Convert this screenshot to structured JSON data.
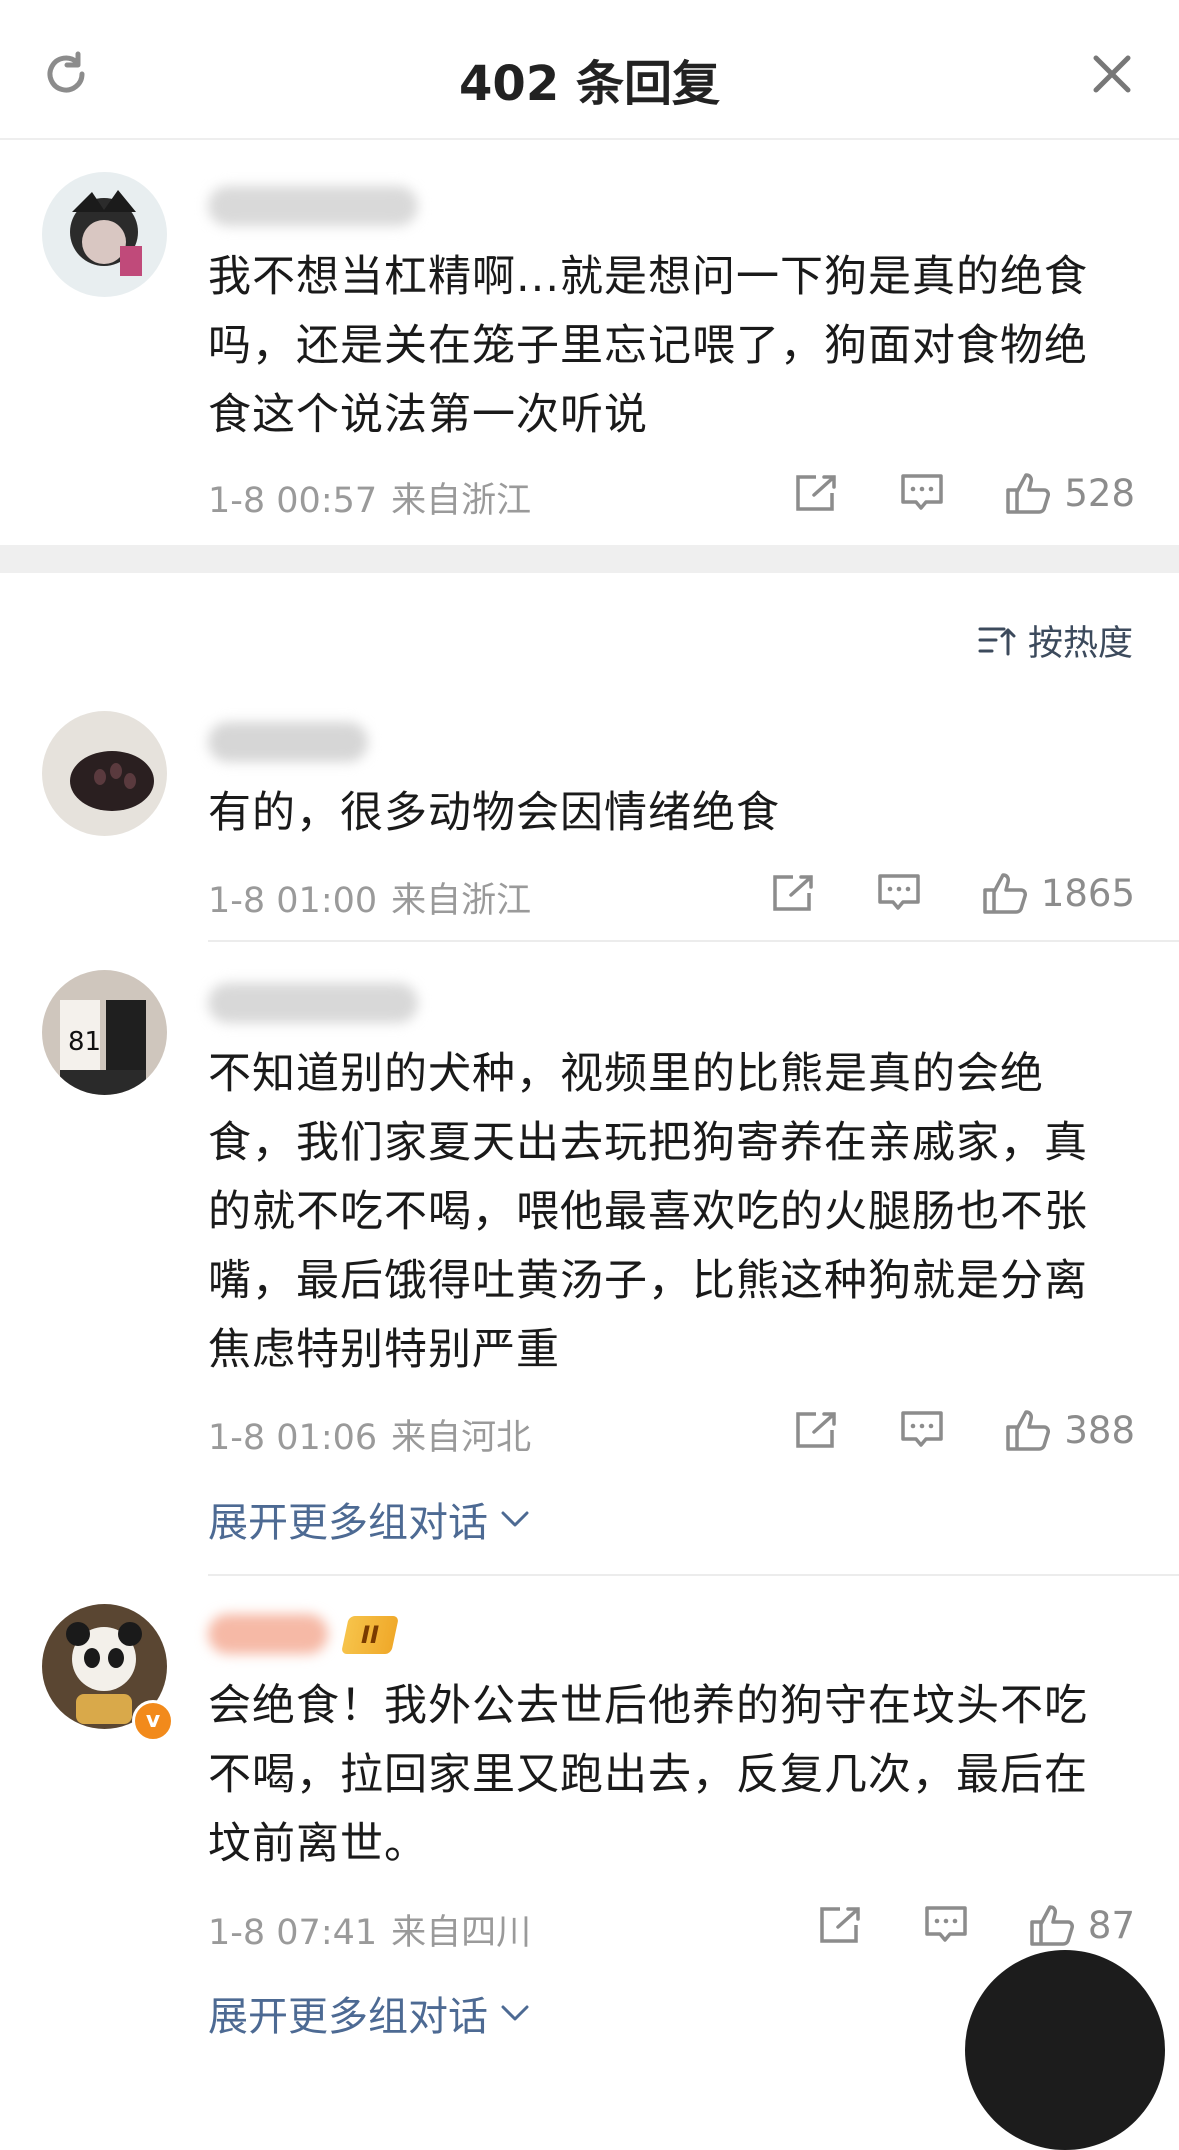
{
  "header": {
    "title": "402 条回复"
  },
  "sort": {
    "label": "按热度"
  },
  "main_comment": {
    "text": "我不想当杠精啊...就是想问一下狗是真的绝食吗，还是关在笼子里忘记喂了，狗面对食物绝食这个说法第一次听说",
    "time": "1-8 00:57",
    "location": "来自浙江",
    "likes": "528"
  },
  "replies": [
    {
      "text": "有的，很多动物会因情绪绝食",
      "time": "1-8 01:00",
      "location": "来自浙江",
      "likes": "1865"
    },
    {
      "text": "不知道别的犬种，视频里的比熊是真的会绝食，我们家夏天出去玩把狗寄养在亲戚家，真的就不吃不喝，喂他最喜欢吃的火腿肠也不张嘴，最后饿得吐黄汤子，比熊这种狗就是分离焦虑特别特别严重",
      "time": "1-8 01:06",
      "location": "来自河北",
      "likes": "388",
      "expand": "展开更多组对话"
    },
    {
      "text": "会绝食！我外公去世后他养的狗守在坟头不吃不喝，拉回家里又跑出去，反复几次，最后在坟前离世。",
      "time": "1-8 07:41",
      "location": "来自四川",
      "likes": "87",
      "expand": "展开更多组对话",
      "level_badge": "II",
      "verified_badge": "v"
    }
  ]
}
